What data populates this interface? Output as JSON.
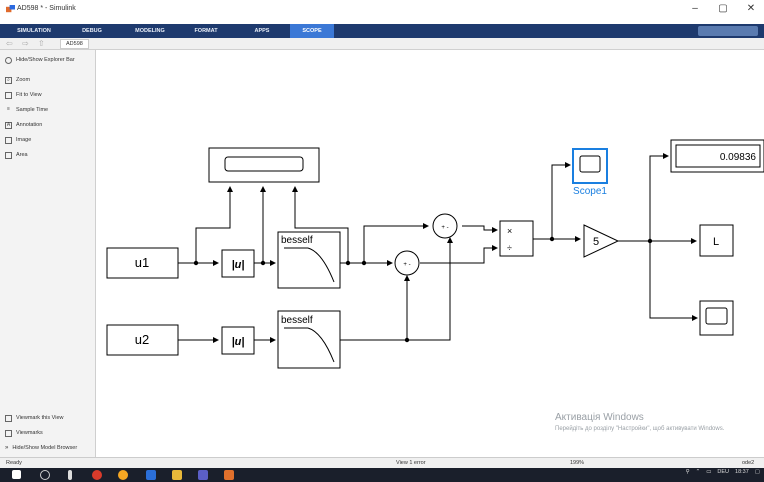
{
  "window": {
    "title": "AD598 * - Simulink",
    "controls": [
      "–",
      "▢",
      "✕"
    ]
  },
  "ribbon": {
    "tabs": [
      "SIMULATION",
      "DEBUG",
      "MODELING",
      "FORMAT",
      "APPS",
      "SCOPE"
    ],
    "active_tab": "SCOPE"
  },
  "toolbar": {
    "breadcrumb": "AD598"
  },
  "sidebar": {
    "top_items": [
      {
        "label": "Hide/Show Explorer Bar",
        "icon": "eye-icon"
      },
      {
        "label": "Zoom",
        "icon": "zoom-icon"
      },
      {
        "label": "Fit to View",
        "icon": "fit-view-icon"
      },
      {
        "label": "Sample Time",
        "icon": "sample-time-icon"
      },
      {
        "label": "Annotation",
        "icon": "annotation-icon"
      },
      {
        "label": "Image",
        "icon": "image-icon"
      },
      {
        "label": "Area",
        "icon": "area-icon"
      }
    ],
    "bottom_items": [
      {
        "label": "Viewmark this View",
        "icon": "viewmark-icon"
      },
      {
        "label": "Viewmarks",
        "icon": "viewmarks-icon"
      },
      {
        "label": "Hide/Show Model Browser",
        "icon": "chevron-icon"
      }
    ]
  },
  "diagram": {
    "input1": "u1",
    "input2": "u2",
    "abs_label": "|u|",
    "filter_label": "besself",
    "sum1_signs": "+ -",
    "sum2_signs": "+ -",
    "product_ops": "×",
    "product_div": "÷",
    "gain": "5",
    "display_value": "0.09836",
    "scope_label": "Scope1",
    "goto_tag": "L"
  },
  "status": {
    "left": "Ready",
    "center": "View 1 error",
    "zoom": "199%",
    "right": "ode2"
  },
  "watermark": {
    "line1": "Активація Windows",
    "line2": "Перейдіть до розділу \"Настройки\", щоб активувати Windows."
  },
  "taskbar": {
    "lang": "DEU",
    "time": "18:37"
  },
  "colors": {
    "ribbon": "#1e3a6e",
    "active_tab": "#3b78d6",
    "selected_block": "#1a7fe0"
  }
}
